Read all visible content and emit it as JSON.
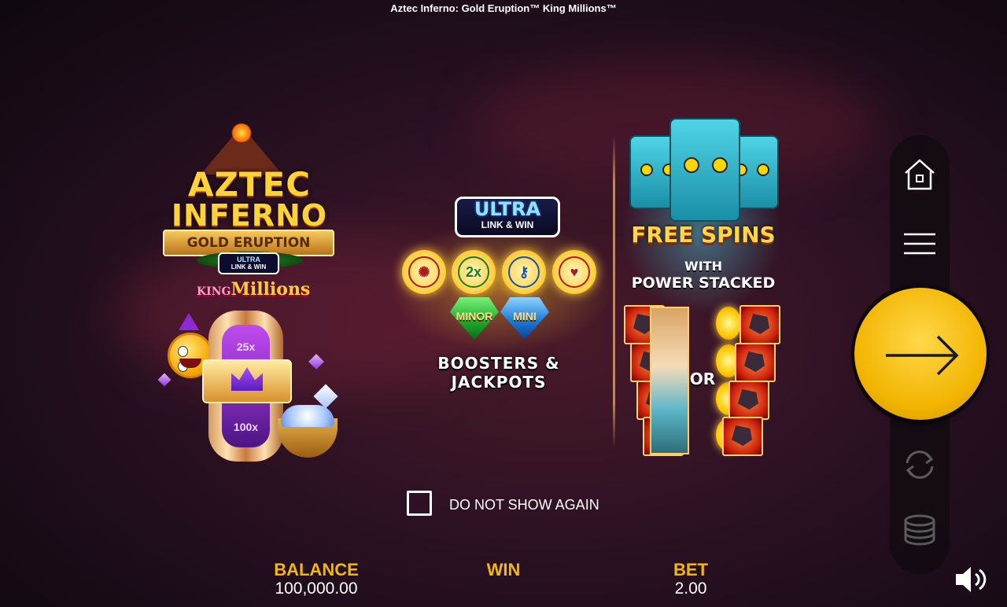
{
  "window": {
    "title": "Aztec Inferno: Gold Eruption™ King Millions™"
  },
  "logo": {
    "line1": "AZTEC",
    "line2": "INFERNO",
    "banner": "GOLD ERUPTION",
    "ultra_top": "ULTRA",
    "ultra_bottom": "LINK & WIN",
    "king_prefix": "KING",
    "king_word": "Millions",
    "reel_values": [
      "25x",
      "100x"
    ]
  },
  "features": {
    "ultra_top": "ULTRA",
    "ultra_bottom": "LINK & WIN",
    "boosters": [
      {
        "icon": "aztec-sun-icon",
        "text": "✺",
        "color": "#b21b1b"
      },
      {
        "icon": "multiplier-icon",
        "text": "2x",
        "color": "#1e7a2a"
      },
      {
        "icon": "key-icon",
        "text": "⚷",
        "color": "#1a4fa8"
      },
      {
        "icon": "heart-respin-icon",
        "text": "♥",
        "color": "#b21b1b"
      }
    ],
    "jackpots": [
      {
        "name": "MINOR",
        "color": "#1fae2e"
      },
      {
        "name": "MINI",
        "color": "#1e7bd8"
      }
    ],
    "caption": "BOOSTERS & JACKPOTS"
  },
  "free_spins": {
    "title": "FREE SPINS",
    "with": "WITH",
    "subtitle": "POWER STACKED",
    "or": "OR"
  },
  "options": {
    "do_not_show_again": "DO NOT SHOW AGAIN",
    "checked": false
  },
  "footer": {
    "balance_label": "BALANCE",
    "balance_value": "100,000.00",
    "win_label": "WIN",
    "win_value": "",
    "bet_label": "BET",
    "bet_value": "2.00"
  },
  "side_panel": {
    "icons": [
      "home-icon",
      "menu-icon",
      "spin-arrow-icon",
      "autoplay-icon",
      "bet-stack-icon",
      "sound-icon"
    ]
  },
  "colors": {
    "accent": "#f5b800",
    "spin_button": "#f2b400"
  }
}
